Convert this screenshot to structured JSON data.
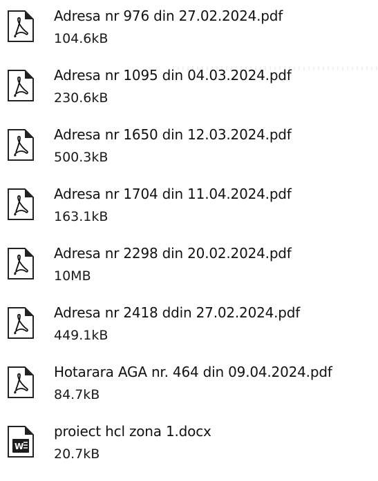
{
  "files": [
    {
      "name": "Adresa nr 976 din 27.02.2024.pdf",
      "size": "104.6kB",
      "icon": "pdf-file-icon"
    },
    {
      "name": "Adresa nr 1095 din 04.03.2024.pdf",
      "size": "230.6kB",
      "icon": "pdf-file-icon"
    },
    {
      "name": "Adresa nr 1650 din 12.03.2024.pdf",
      "size": "500.3kB",
      "icon": "pdf-file-icon"
    },
    {
      "name": "Adresa nr 1704 din 11.04.2024.pdf",
      "size": "163.1kB",
      "icon": "pdf-file-icon"
    },
    {
      "name": "Adresa nr 2298 din 20.02.2024.pdf",
      "size": "10MB",
      "icon": "pdf-file-icon"
    },
    {
      "name": "Adresa nr 2418 ddin 27.02.2024.pdf",
      "size": "449.1kB",
      "icon": "pdf-file-icon"
    },
    {
      "name": "Hotarara AGA nr. 464 din 09.04.2024.pdf",
      "size": "84.7kB",
      "icon": "pdf-file-icon"
    },
    {
      "name": "proiect hcl zona 1.docx",
      "size": "20.7kB",
      "icon": "word-file-icon"
    }
  ]
}
